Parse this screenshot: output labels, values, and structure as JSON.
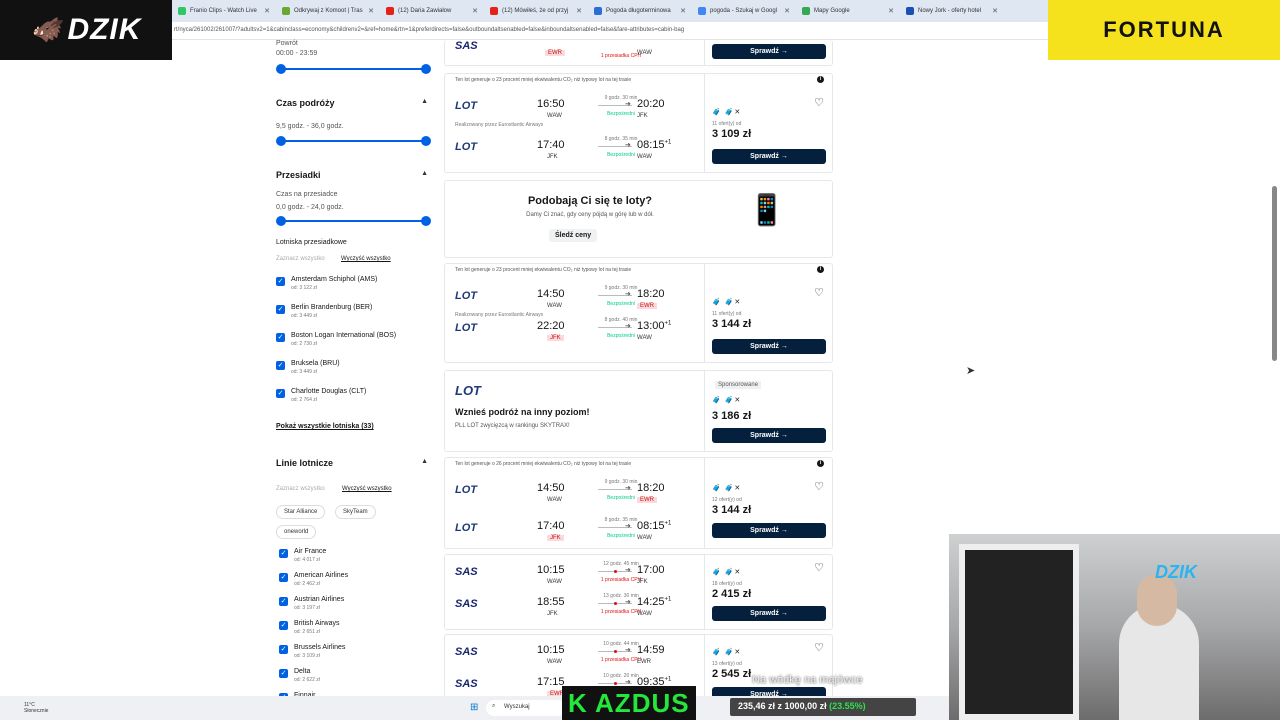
{
  "tabs": [
    {
      "label": "Franio Clips - Watch Live",
      "color": "#2ec866"
    },
    {
      "label": "Odkrywaj z Komoot | Tras",
      "color": "#6aa82f"
    },
    {
      "label": "(12) Daria Zawiałow",
      "color": "#e62117"
    },
    {
      "label": "(12) Mówiłeś, że od przyj",
      "color": "#e62117"
    },
    {
      "label": "Pogoda długoterminowa",
      "color": "#2b6fd6"
    },
    {
      "label": "pogoda - Szukaj w Googl",
      "color": "#4285f4"
    },
    {
      "label": "Mapy Google",
      "color": "#34a853"
    },
    {
      "label": "Nowy Jork - oferty hotel",
      "color": "#1a4fb4"
    }
  ],
  "url": "rt/nyca/261002/261007/?adultsv2=1&cabinclass=economy&childrenv2=&ref=home&rtn=1&preferdirects=false&outboundaltsenabled=false&inboundaltsenabled=false&fare-attributes=cabin-bag",
  "overlay": {
    "brand_left": "DZIK",
    "brand_right": "FORTUNA",
    "cam_logo": "DZIK",
    "streamer": "K AZDUS",
    "balance_value": "235,46 zł",
    "balance_mid": "z 1000,00 zł",
    "balance_pct": "(23.55%)",
    "subtitle": "Na wódkę na majówce",
    "weather_temp": "11°C",
    "weather_text": "Słonecznie",
    "search": "Wyszukaj"
  },
  "filters": {
    "dep_label": "Powrót",
    "dep_range": "00:00 - 23:59",
    "duration_title": "Czas podróży",
    "duration_range": "9,5 godz. - 36,0 godz.",
    "stops_title": "Przesiadki",
    "layover_label": "Czas na przesiadce",
    "layover_range": "0,0 godz. - 24,0 godz.",
    "airports_label": "Lotniska przesiadkowe",
    "select_all": "Zaznacz wszystko",
    "clear_all": "Wyczyść wszystko",
    "airports": [
      {
        "name": "Amsterdam Schiphol (AMS)",
        "price": "od: 3 122 zł"
      },
      {
        "name": "Berlin Brandenburg (BER)",
        "price": "od: 3 449 zł"
      },
      {
        "name": "Boston Logan International (BOS)",
        "price": "od: 2 730 zł"
      },
      {
        "name": "Bruksela (BRU)",
        "price": "od: 3 449 zł"
      },
      {
        "name": "Charlotte Douglas (CLT)",
        "price": "od: 2 764 zł"
      }
    ],
    "show_all": "Pokaż wszystkie lotniska (33)",
    "airlines_title": "Linie lotnicze",
    "alliances": [
      "Star Alliance",
      "SkyTeam",
      "oneworld"
    ],
    "airlines": [
      {
        "name": "Air France",
        "price": "od: 4 017 zł"
      },
      {
        "name": "American Airlines",
        "price": "od: 2 462 zł"
      },
      {
        "name": "Austrian Airlines",
        "price": "od: 3 197 zł"
      },
      {
        "name": "British Airways",
        "price": "od: 2 651 zł"
      },
      {
        "name": "Brussels Airlines",
        "price": "od: 3 109 zł"
      },
      {
        "name": "Delta",
        "price": "od: 2 622 zł"
      },
      {
        "name": "Finnair",
        "price": ""
      }
    ]
  },
  "results": {
    "top_partial": {
      "dep_ap": "EWR",
      "stop": "1 przesiadka CPH",
      "arr_ap": "WAW",
      "button": "Sprawdź →"
    },
    "card1": {
      "eco": "Ten lot generuje o 23 procent mniej ekwiwalentu CO₂ niż typowy lot na tej trasie",
      "airline": "LOT",
      "out": {
        "dep": "16:50",
        "dep_ap": "WAW",
        "dur": "9 godz. 30 min",
        "stops": "Bezpośredni",
        "arr": "20:20",
        "arr_ap": "JFK"
      },
      "operated": "Realizowany przez Eurostlantic Airways",
      "ret": {
        "dep": "17:40",
        "dep_ap": "JFK",
        "dur": "8 godz. 35 min",
        "stops": "Bezpośredni",
        "arr": "08:15",
        "arr_plus": "+1",
        "arr_ap": "WAW"
      },
      "bags": "🧳 🧳✕",
      "offers": "11 ofert(y) od",
      "price": "3 109 zł",
      "button": "Sprawdź →"
    },
    "promo": {
      "title": "Podobają Ci się te loty?",
      "sub": "Damy Ci znać, gdy ceny pójdą w górę lub w dół.",
      "button": "Śledź ceny"
    },
    "card2": {
      "eco": "Ten lot generuje o 23 procent mniej ekwiwalentu CO₂ niż typowy lot na tej trasie",
      "airline": "LOT",
      "out": {
        "dep": "14:50",
        "dep_ap": "WAW",
        "dur": "9 godz. 30 min",
        "stops": "Bezpośredni",
        "arr": "18:20",
        "arr_ap": "EWR"
      },
      "ret": {
        "dep": "22:20",
        "dep_ap": "JFK",
        "dur": "8 godz. 40 min",
        "stops": "Bezpośredni",
        "arr": "13:00",
        "arr_plus": "+1",
        "arr_ap": "WAW"
      },
      "operated": "Realizowany przez Eurostlantic Airways",
      "bags": "🧳 🧳✕",
      "offers": "11 ofert(y) od",
      "price": "3 144 zł",
      "button": "Sprawdź →"
    },
    "ad": {
      "airline": "LOT",
      "title": "Wznieś podróż na inny poziom!",
      "sub": "PLL LOT zwycięzcą w rankingu SKYTRAX!",
      "sponsored": "Sponsorowane",
      "bags": "🧳 🧳✕",
      "price": "3 186 zł",
      "button": "Sprawdź →"
    },
    "card3": {
      "eco": "Ten lot generuje o 26 procent mniej ekwiwalentu CO₂ niż typowy lot na tej trasie",
      "airline": "LOT",
      "out": {
        "dep": "14:50",
        "dep_ap": "WAW",
        "dur": "9 godz. 30 min",
        "stops": "Bezpośredni",
        "arr": "18:20",
        "arr_ap": "EWR"
      },
      "ret": {
        "dep": "17:40",
        "dep_ap": "JFK",
        "dur": "8 godz. 35 min",
        "stops": "Bezpośredni",
        "arr": "08:15",
        "arr_plus": "+1",
        "arr_ap": "WAW"
      },
      "bags": "🧳 🧳✕",
      "offers": "12 ofert(y) od",
      "price": "3 144 zł",
      "button": "Sprawdź →"
    },
    "card4": {
      "airline": "SAS",
      "out": {
        "dep": "10:15",
        "dep_ap": "WAW",
        "dur": "12 godz. 45 min",
        "stops": "1 przesiadka CPH",
        "arr": "17:00",
        "arr_ap": "JFK"
      },
      "ret": {
        "dep": "18:55",
        "dep_ap": "JFK",
        "dur": "13 godz. 30 min",
        "stops": "1 przesiadka CPH",
        "arr": "14:25",
        "arr_plus": "+1",
        "arr_ap": "WAW"
      },
      "bags": "🧳 🧳✕",
      "offers": "18 ofert(y) od",
      "price": "2 415 zł",
      "button": "Sprawdź →"
    },
    "card5": {
      "airline": "SAS",
      "out": {
        "dep": "10:15",
        "dep_ap": "WAW",
        "dur": "10 godz. 44 min",
        "stops": "1 przesiadka CPH",
        "arr": "14:59",
        "arr_ap": "EWR"
      },
      "ret": {
        "dep": "17:15",
        "dep_ap": "EWR",
        "dur": "10 godz. 20 min",
        "stops": "1 przesiadka CPH",
        "arr": "09:35",
        "arr_plus": "+1",
        "arr_ap": "WAW"
      },
      "bags": "🧳 🧳✕",
      "offers": "13 ofert(y) od",
      "price": "2 545 zł",
      "button": "Sprawdź →"
    }
  }
}
